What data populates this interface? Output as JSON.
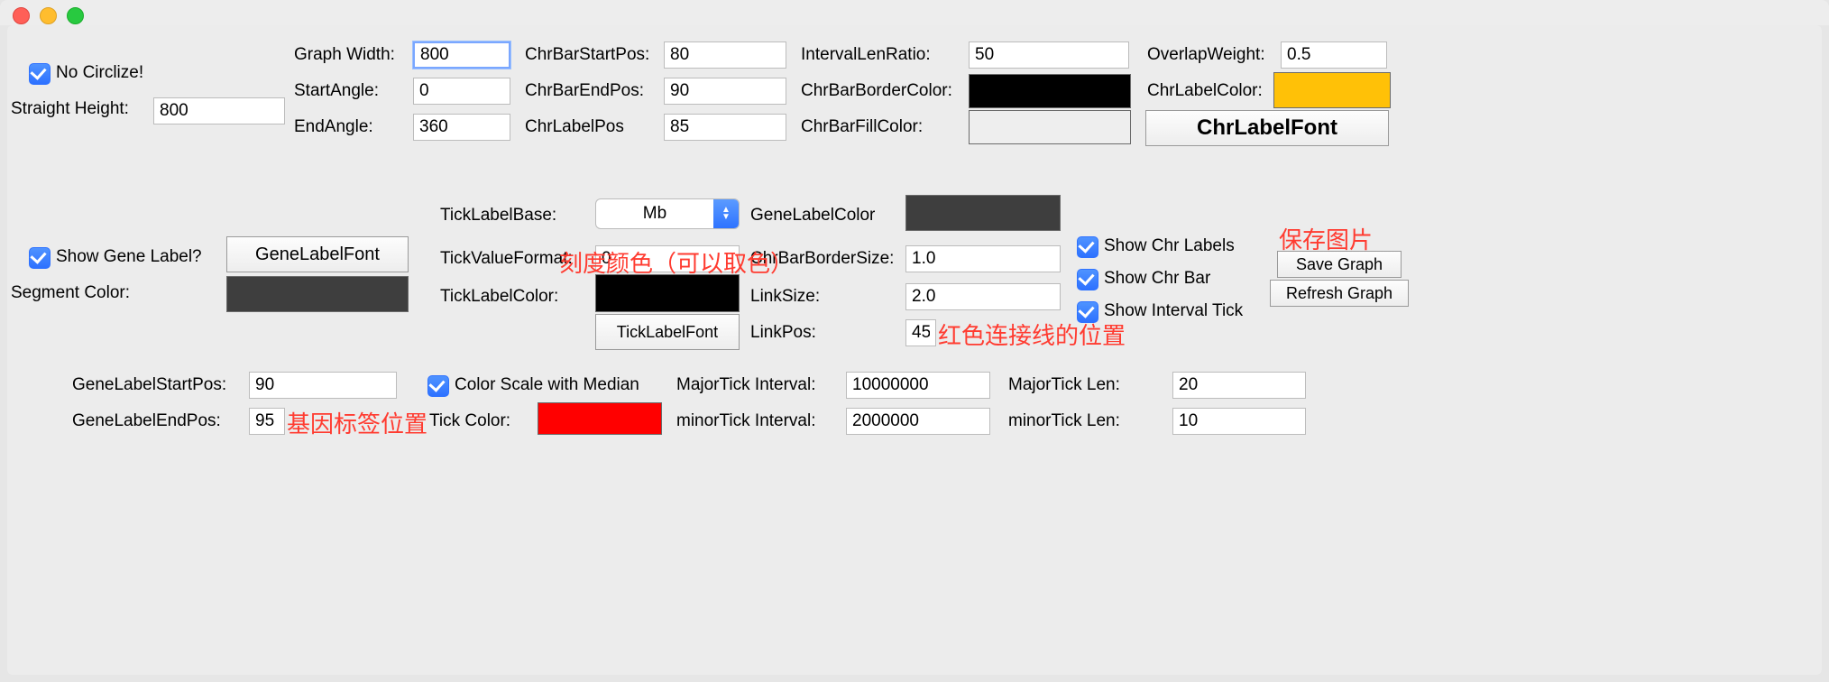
{
  "titlebar": {
    "title": ""
  },
  "sec1": {
    "no_circlize_label": "No Circlize!",
    "straight_height_label": "Straight Height:",
    "straight_height_value": "800",
    "graph_width_label": "Graph Width:",
    "graph_width_value": "800",
    "start_angle_label": "StartAngle:",
    "start_angle_value": "0",
    "end_angle_label": "EndAngle:",
    "end_angle_value": "360",
    "chrbar_startpos_label": "ChrBarStartPos:",
    "chrbar_startpos_value": "80",
    "chrbar_endpos_label": "ChrBarEndPos:",
    "chrbar_endpos_value": "90",
    "chrlabel_pos_label": "ChrLabelPos",
    "chrlabel_pos_value": "85",
    "interval_len_ratio_label": "IntervalLenRatio:",
    "interval_len_ratio_value": "50",
    "chrbar_border_color_label": "ChrBarBorderColor:",
    "chrbar_border_color_hex": "#000000",
    "chrbar_fill_color_label": "ChrBarFillColor:",
    "chrbar_fill_color_hex": "#eeeeee",
    "overlap_weight_label": "OverlapWeight:",
    "overlap_weight_value": "0.5",
    "chrlabel_color_label": "ChrLabelColor:",
    "chrlabel_color_hex": "#ffc107",
    "chrlabel_font_btn": "ChrLabelFont"
  },
  "sec2": {
    "show_gene_label_cb_label": "Show Gene Label?",
    "gene_label_font_btn": "GeneLabelFont",
    "segment_color_label": "Segment Color:",
    "segment_color_hex": "#3e3e3e",
    "tick_label_base_label": "TickLabelBase:",
    "tick_label_base_value": "Mb",
    "tick_value_format_label": "TickValueFormat:",
    "tick_value_format_value": "0",
    "tick_label_color_label": "TickLabelColor:",
    "tick_label_color_hex": "#000000",
    "tick_label_font_btn": "TickLabelFont",
    "gene_label_color_label": "GeneLabelColor",
    "gene_label_color_hex": "#3e3e3e",
    "chrbar_border_size_label": "ChrBarBorderSize:",
    "chrbar_border_size_value": "1.0",
    "link_size_label": "LinkSize:",
    "link_size_value": "2.0",
    "link_pos_label": "LinkPos:",
    "link_pos_value": "45",
    "show_chr_labels_label": "Show Chr Labels",
    "show_chr_bar_label": "Show Chr Bar",
    "show_interval_tick_label": "Show Interval Tick",
    "save_graph_btn": "Save Graph",
    "refresh_graph_btn": "Refresh Graph"
  },
  "sec3": {
    "gene_label_startpos_label": "GeneLabelStartPos:",
    "gene_label_startpos_value": "90",
    "gene_label_endpos_label": "GeneLabelEndPos:",
    "gene_label_endpos_value": "95",
    "color_scale_median_label": "Color Scale with Median",
    "tick_color_label": "Tick Color:",
    "tick_color_hex": "#ff0000",
    "major_tick_interval_label": "MajorTick Interval:",
    "major_tick_interval_value": "10000000",
    "minor_tick_interval_label": "minorTick Interval:",
    "minor_tick_interval_value": "2000000",
    "major_tick_len_label": "MajorTick Len:",
    "major_tick_len_value": "20",
    "minor_tick_len_label": "minorTick Len:",
    "minor_tick_len_value": "10"
  },
  "annotations": {
    "tick_color_note": "刻度颜色（可以取色）",
    "link_pos_note": "红色连接线的位置",
    "gene_label_pos_note": "基因标签位置",
    "save_graph_note": "保存图片"
  }
}
